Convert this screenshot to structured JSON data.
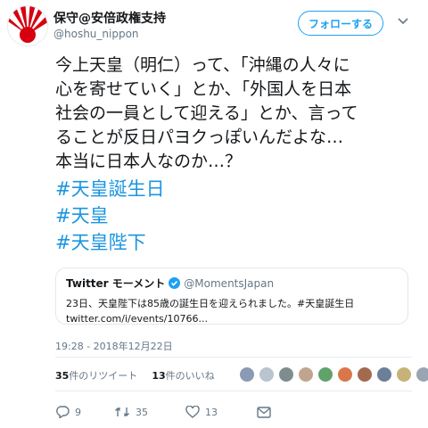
{
  "tweet": {
    "user": {
      "name": "保守@安倍政権支持",
      "handle": "@hoshu_nippon"
    },
    "follow_label": "フォローする",
    "text_lines": [
      "今上天皇（明仁）って、「沖縄の人々に",
      "心を寄せていく」とか、「外国人を日本",
      "社会の一員として迎える」とか、言って",
      "ることが反日パヨクっぽいんだよな…",
      "本当に日本人なのか…？"
    ],
    "hashtags": [
      "#天皇誕生日",
      "#天皇",
      "#天皇陛下"
    ],
    "quoted_card": {
      "name": "Twitter モーメント",
      "handle": "@MomentsJapan",
      "text": "23日、天皇陛下は85歳の誕生日を迎えられました。#天皇誕生日",
      "link": "twitter.com/i/events/10766..."
    },
    "timestamp": "19:28 - 2018年12月22日",
    "retweets": {
      "count": "35",
      "label": "件のリツイート"
    },
    "likes": {
      "count": "13",
      "label": "件のいいね"
    },
    "actions": {
      "reply_count": "9",
      "retweet_count": "35",
      "like_count": "13"
    },
    "liker_colors": [
      "#8a9bb3",
      "#b9c4cf",
      "#7f8c8d",
      "#c0a58e",
      "#5fa36b",
      "#d9774b",
      "#a36a4f",
      "#6b7f99",
      "#c8b27a",
      "#9aa5b1"
    ],
    "colors": {
      "link": "#1b95e0",
      "brand": "#1da1f2",
      "avatar_sun": "#d7000f"
    }
  }
}
